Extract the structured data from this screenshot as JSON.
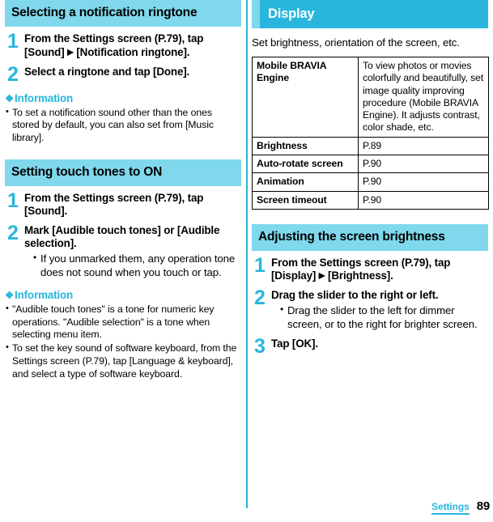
{
  "page": {
    "footer_tab": "Settings",
    "footer_page_number": "89",
    "accent_color": "#29b6dc",
    "header_light_color": "#7fd8ec"
  },
  "left_column": {
    "section1": {
      "heading": "Selecting a notification ringtone",
      "steps": [
        {
          "number": "1",
          "title_parts": {
            "before": "From the Settings screen (P.79), tap [Sound] ",
            "triangle": "▶",
            "after": " [Notification ringtone]."
          }
        },
        {
          "number": "2",
          "title": "Select a ringtone and tap [Done]."
        }
      ],
      "information": {
        "glyph": "❖",
        "label": "Information",
        "items": [
          "To set a notification sound other than the ones stored by default, you can also set from [Music library]."
        ]
      }
    },
    "section2": {
      "heading": "Setting touch tones to ON",
      "steps": [
        {
          "number": "1",
          "title": "From the Settings screen (P.79), tap [Sound]."
        },
        {
          "number": "2",
          "title": "Mark [Audible touch tones] or [Audible selection].",
          "bullets": [
            "If you unmarked them, any operation tone does not sound when you touch or tap."
          ]
        }
      ],
      "information": {
        "glyph": "❖",
        "label": "Information",
        "items": [
          "\"Audible touch tones\" is a tone for numeric key operations. \"Audible selection\" is a tone when selecting menu item.",
          "To set the key sound of software keyboard, from the Settings screen (P.79), tap [Language & keyboard], and select a type of software keyboard."
        ]
      }
    }
  },
  "right_column": {
    "section1": {
      "heading": "Display",
      "lead": "Set brightness, orientation of the screen, etc.",
      "table": {
        "rows": [
          {
            "key": "Mobile BRAVIA Engine",
            "value": "To view photos or movies colorfully and beautifully, set image quality improving procedure (Mobile BRAVIA Engine). It adjusts contrast, color shade, etc."
          },
          {
            "key": "Brightness",
            "value": "P.89"
          },
          {
            "key": "Auto-rotate screen",
            "value": "P.90"
          },
          {
            "key": "Animation",
            "value": "P.90"
          },
          {
            "key": "Screen timeout",
            "value": "P.90"
          }
        ]
      }
    },
    "section2": {
      "heading": "Adjusting the screen brightness",
      "steps": [
        {
          "number": "1",
          "title_parts": {
            "before": "From the Settings screen (P.79), tap [Display] ",
            "triangle": "▶",
            "after": " [Brightness]."
          }
        },
        {
          "number": "2",
          "title": "Drag the slider to the right or left.",
          "bullets": [
            "Drag the slider to the left for dimmer screen, or to the right for brighter screen."
          ]
        },
        {
          "number": "3",
          "title": "Tap [OK]."
        }
      ]
    }
  }
}
